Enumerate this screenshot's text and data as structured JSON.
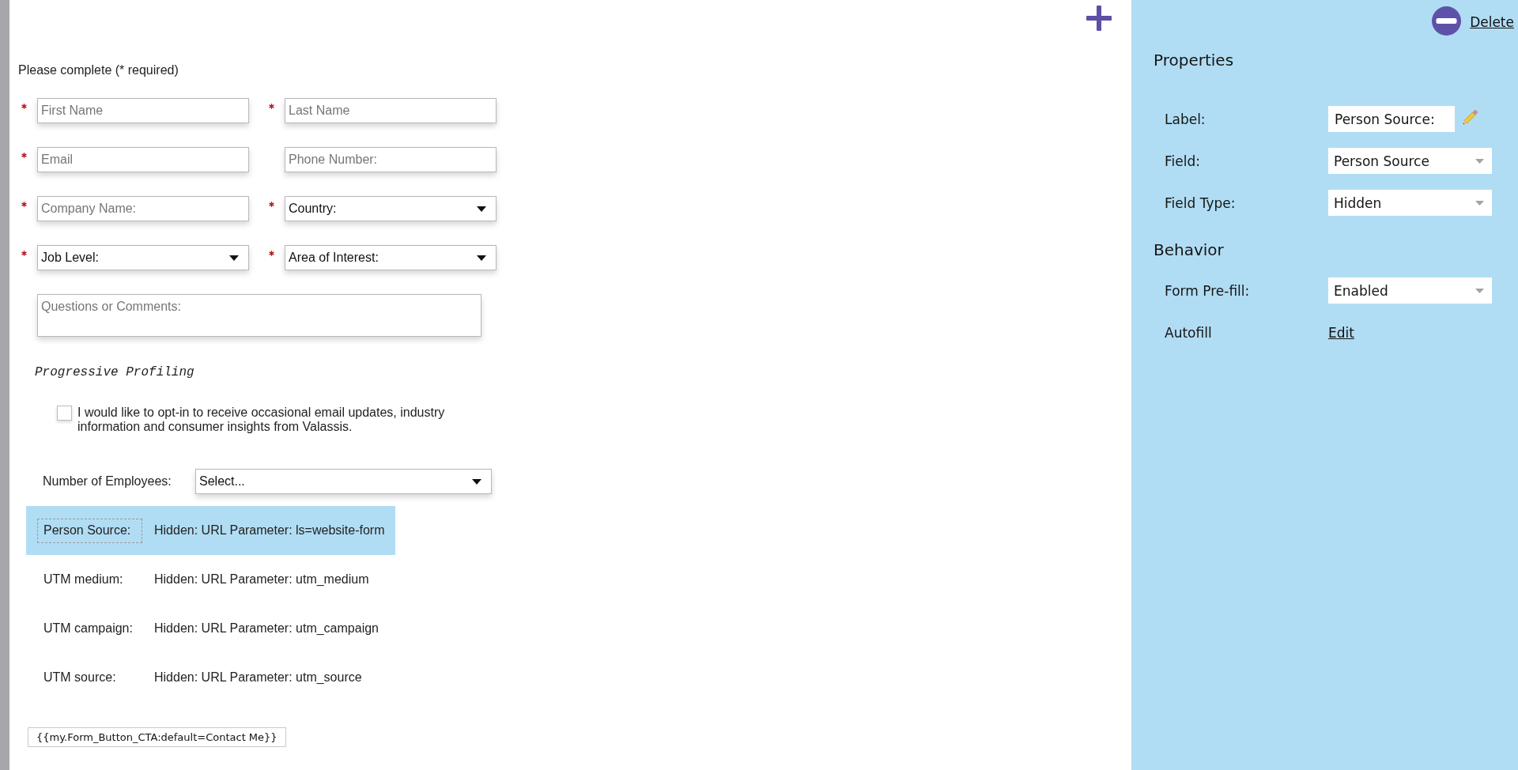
{
  "form": {
    "instructions": "Please complete (* required)",
    "fields": [
      {
        "kind": "text",
        "placeholder": "First Name",
        "required": true
      },
      {
        "kind": "text",
        "placeholder": "Last Name",
        "required": true
      },
      {
        "kind": "text",
        "placeholder": "Email",
        "required": true
      },
      {
        "kind": "text",
        "placeholder": "Phone Number:",
        "required": false
      },
      {
        "kind": "text",
        "placeholder": "Company Name:",
        "required": true
      },
      {
        "kind": "select",
        "value": "Country:",
        "required": true
      },
      {
        "kind": "select",
        "value": "Job Level:",
        "required": true
      },
      {
        "kind": "select",
        "value": "Area of Interest:",
        "required": true
      },
      {
        "kind": "textarea",
        "placeholder": "Questions or Comments:",
        "required": false
      }
    ],
    "section_title": "Progressive Profiling",
    "opt_in": {
      "text": "I would like to opt-in to receive occasional email updates, industry information and consumer insights from Valassis.",
      "checked": false
    },
    "employees": {
      "label": "Number of Employees:",
      "value": "Select..."
    },
    "hidden_fields": [
      {
        "label": "Person Source:",
        "value": "Hidden: URL Parameter: ls=website-form",
        "selected": true
      },
      {
        "label": "UTM medium:",
        "value": "Hidden: URL Parameter: utm_medium",
        "selected": false
      },
      {
        "label": "UTM campaign:",
        "value": "Hidden: URL Parameter: utm_campaign",
        "selected": false
      },
      {
        "label": "UTM source:",
        "value": "Hidden: URL Parameter: utm_source",
        "selected": false
      }
    ],
    "submit_button": {
      "label": "{{my.Form_Button_CTA:default=Contact Me}}"
    }
  },
  "properties_panel": {
    "delete_label": "Delete",
    "sections": [
      {
        "title": "Properties",
        "rows": [
          {
            "kind": "text",
            "label": "Label:",
            "value": "Person Source:"
          },
          {
            "kind": "select",
            "label": "Field:",
            "value": "Person Source"
          },
          {
            "kind": "select",
            "label": "Field Type:",
            "value": "Hidden"
          }
        ]
      },
      {
        "title": "Behavior",
        "rows": [
          {
            "kind": "select",
            "label": "Form Pre-fill:",
            "value": "Enabled"
          },
          {
            "kind": "link",
            "label": "Autofill",
            "value": "Edit"
          }
        ]
      }
    ]
  }
}
